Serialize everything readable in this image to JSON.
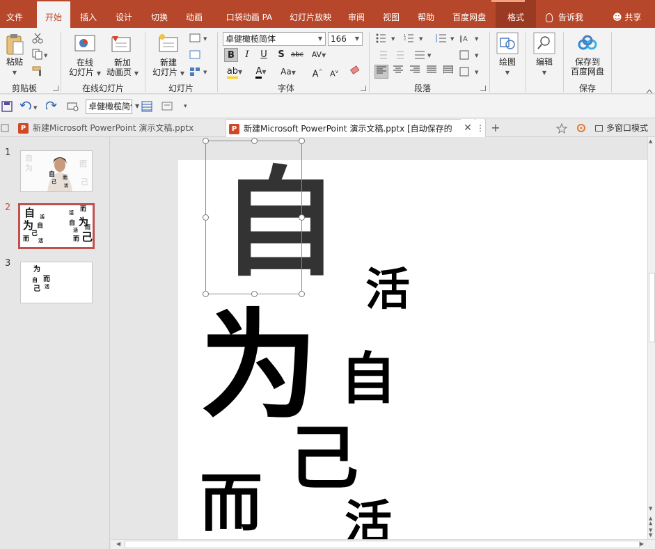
{
  "tabs": [
    {
      "label": "文件"
    },
    {
      "label": "开始"
    },
    {
      "label": "插入"
    },
    {
      "label": "设计"
    },
    {
      "label": "切换"
    },
    {
      "label": "动画"
    },
    {
      "label": "口袋动画 PA"
    },
    {
      "label": "幻灯片放映"
    },
    {
      "label": "审阅"
    },
    {
      "label": "视图"
    },
    {
      "label": "帮助"
    },
    {
      "label": "百度网盘"
    },
    {
      "label": "格式"
    }
  ],
  "tellme": "告诉我",
  "share": "共享",
  "ribbon": {
    "clipboard": {
      "paste": "粘贴",
      "label": "剪贴板"
    },
    "online_slides": {
      "online": "在线\n幻灯片",
      "new_anim": "新加\n动画页",
      "label": "在线幻灯片"
    },
    "slides": {
      "new_slide": "新建\n幻灯片",
      "label": "幻灯片"
    },
    "font": {
      "font_name": "卓健橄榄简体",
      "font_size": "166",
      "label": "字体"
    },
    "paragraph": {
      "label": "段落"
    },
    "drawing": {
      "draw": "绘图"
    },
    "editing": {
      "edit": "编辑"
    },
    "save": {
      "save_to": "保存到\n百度网盘",
      "label": "保存"
    }
  },
  "qat": {
    "font_name": "卓健橄榄简体"
  },
  "doc_tabs": [
    {
      "label": "新建Microsoft PowerPoint 演示文稿.pptx"
    },
    {
      "label": "新建Microsoft PowerPoint 演示文稿.pptx [自动保存的"
    }
  ],
  "multi_window": "多窗口模式",
  "slides": [
    {
      "num": "1"
    },
    {
      "num": "2"
    },
    {
      "num": "3"
    }
  ],
  "slide_text": {
    "c1": "自",
    "c2": "活",
    "c3": "为",
    "c4": "自",
    "c5": "己",
    "c6": "而",
    "c7": "活"
  },
  "thumb2": [
    "自",
    "活",
    "为",
    "自",
    "己",
    "而",
    "活",
    "而",
    "活",
    "自",
    "为",
    "而",
    "活",
    "而",
    "己"
  ],
  "thumb3": [
    "为",
    "自",
    "而",
    "己",
    "活"
  ],
  "colors": {
    "accent": "#b7472a",
    "selected_thumb": "#c0504d"
  }
}
